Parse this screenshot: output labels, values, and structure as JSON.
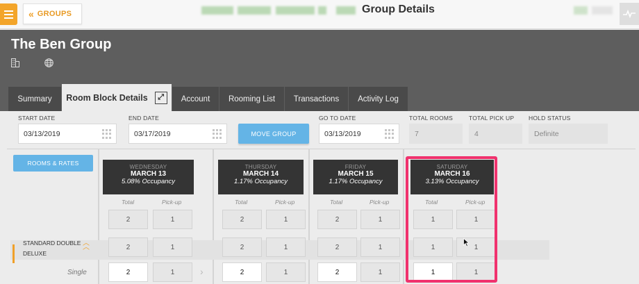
{
  "topbar": {
    "groups_label": "GROUPS",
    "page_title": "Group Details"
  },
  "header": {
    "group_name": "The Ben Group"
  },
  "tabs": [
    {
      "label": "Summary"
    },
    {
      "label": "Room Block Details"
    },
    {
      "label": "Account"
    },
    {
      "label": "Rooming List"
    },
    {
      "label": "Transactions"
    },
    {
      "label": "Activity Log"
    }
  ],
  "form": {
    "start_date_label": "START DATE",
    "start_date": "03/13/2019",
    "end_date_label": "END DATE",
    "end_date": "03/17/2019",
    "move_group_label": "MOVE GROUP",
    "go_to_date_label": "GO TO DATE",
    "go_to_date": "03/13/2019",
    "total_rooms_label": "TOTAL ROOMS",
    "total_rooms": "7",
    "total_pickup_label": "TOTAL PICK UP",
    "total_pickup": "4",
    "hold_status_label": "HOLD STATUS",
    "hold_status": "Definite"
  },
  "grid": {
    "rooms_rates_label": "ROOMS & RATES",
    "room_type": "STANDARD DOUBLE DELUXE",
    "single_label": "Single",
    "total_label": "Total",
    "pickup_label": "Pick-up",
    "days": [
      {
        "dow": "WEDNESDAY",
        "date": "MARCH 13",
        "occupancy": "5.08% Occupancy",
        "totals": [
          "2",
          "2",
          "2"
        ],
        "pickups": [
          "1",
          "1",
          "1"
        ]
      },
      {
        "dow": "THURSDAY",
        "date": "MARCH 14",
        "occupancy": "1.17% Occupancy",
        "totals": [
          "2",
          "2",
          "2"
        ],
        "pickups": [
          "1",
          "1",
          "1"
        ]
      },
      {
        "dow": "FRIDAY",
        "date": "MARCH 15",
        "occupancy": "1.17% Occupancy",
        "totals": [
          "2",
          "2",
          "2"
        ],
        "pickups": [
          "1",
          "1",
          "1"
        ]
      },
      {
        "dow": "SATURDAY",
        "date": "MARCH 16",
        "occupancy": "3.13% Occupancy",
        "totals": [
          "1",
          "1",
          "1"
        ],
        "pickups": [
          "1",
          "1",
          "1"
        ]
      }
    ]
  },
  "colors": {
    "accent": "#f0a028",
    "button_blue": "#64b4e6",
    "highlight": "#f0326e"
  }
}
